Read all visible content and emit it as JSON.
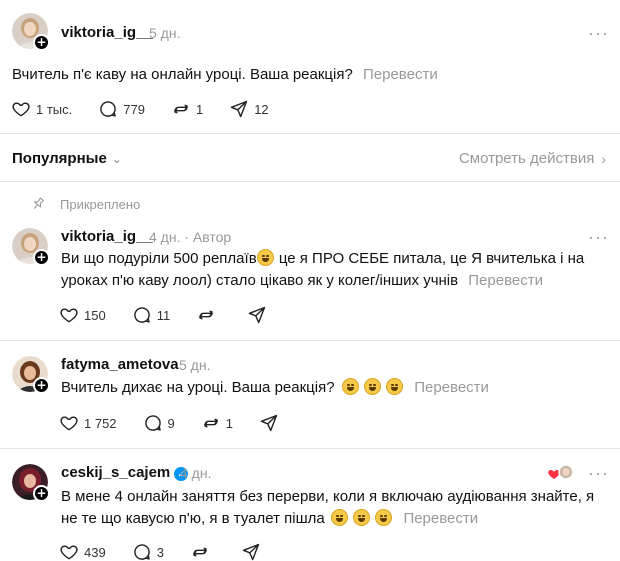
{
  "post": {
    "username": "viktoria_ig__",
    "time": "5 дн.",
    "text": "Вчитель п'є каву на онлайн уроці. Ваша реакція?",
    "translate": "Перевести",
    "likes": "1 тыс.",
    "comments": "779",
    "reposts": "1",
    "shares": "12"
  },
  "sort": {
    "label": "Популярные",
    "activity": "Смотреть действия"
  },
  "replies": [
    {
      "pinned_label": "Прикреплено",
      "username": "viktoria_ig__",
      "time": "4 дн.",
      "author": "· Автор",
      "text_1": "Ви що подуріли 500 реплаїв",
      "text_2": " це я ПРО СЕБЕ питала, це Я вчителька і на",
      "text_3": "уроках п'ю каву лоол) стало цікаво як у колег/інших учнів",
      "translate": "Перевести",
      "likes": "150",
      "comments": "11"
    },
    {
      "username": "fatyma_ametova",
      "time": "5 дн.",
      "text": "Вчитель дихає на уроці. Ваша реакція?",
      "translate": "Перевести",
      "likes": "1 752",
      "comments": "9",
      "reposts": "1"
    },
    {
      "username": "ceskij_s_cajem",
      "time": "4 дн.",
      "text_1": "В мене 4 онлайн заняття без перерви, коли я включаю аудіювання знайте, я",
      "text_2": "не те що кавусю п'ю, я в туалет пішла",
      "translate": "Перевести",
      "likes": "439",
      "comments": "3"
    }
  ],
  "more_label": "···",
  "colors": {
    "muted": "#999999",
    "text": "#111111",
    "verified": "#0095f6",
    "divider": "#e3e3e3"
  }
}
